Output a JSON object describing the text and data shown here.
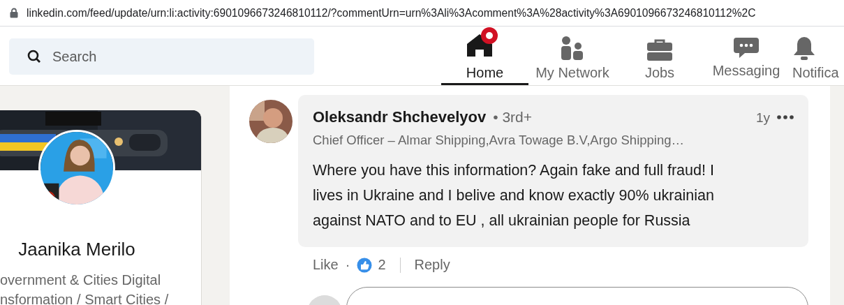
{
  "address_bar": {
    "url": "linkedin.com/feed/update/urn:li:activity:6901096673246810112/?commentUrn=urn%3Ali%3Acomment%3A%28activity%3A6901096673246810112%2C"
  },
  "nav": {
    "search": {
      "placeholder": "Search"
    },
    "items": [
      {
        "kind": "home",
        "label": "Home",
        "selected": true,
        "badge": true
      },
      {
        "kind": "network",
        "label": "My Network",
        "selected": false,
        "badge": false
      },
      {
        "kind": "jobs",
        "label": "Jobs",
        "selected": false,
        "badge": false
      },
      {
        "kind": "messaging",
        "label": "Messaging",
        "selected": false,
        "badge": false
      },
      {
        "kind": "notifications",
        "label": "Notifica",
        "selected": false,
        "badge": false
      }
    ]
  },
  "profile": {
    "name": "Jaanika Merilo",
    "headline": [
      "overnment & Cities Digital",
      "nsformation / Smart Cities /"
    ]
  },
  "comment": {
    "author": "Oleksandr Shchevelyov",
    "degree": "• 3rd+",
    "time": "1y",
    "subtitle": "Chief Officer – Almar Shipping,Avra Towage B.V,Argo Shipping…",
    "text": "Where you have this information? Again fake and full fraud! I lives in Ukraine and I belive and know exactly 90% ukrainian against NATO and to EU , all ukrainian people for Russia",
    "like": "Like",
    "separator": "·",
    "reaction_count": "2",
    "reply": "Reply"
  }
}
